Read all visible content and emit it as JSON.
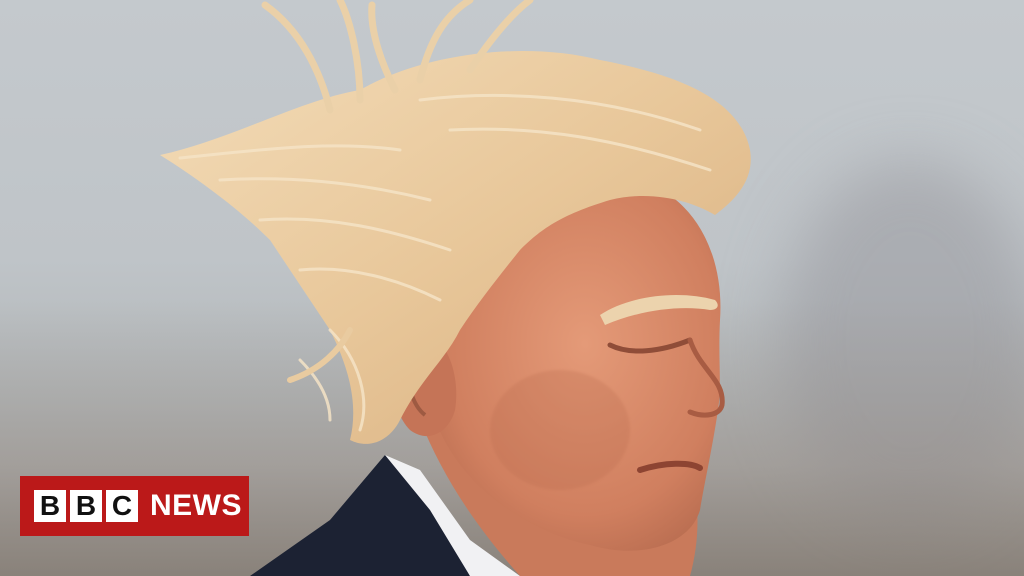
{
  "photo": {
    "description_subject": "",
    "colors": {
      "sky": "#c4c9cd",
      "hair": "#e8c79a",
      "skin": "#d98a6a",
      "suit": "#1c2233",
      "shirt": "#f1f1f3"
    }
  },
  "logo": {
    "letters": [
      "B",
      "B",
      "C"
    ],
    "word": "NEWS",
    "color": "#bb1919"
  }
}
